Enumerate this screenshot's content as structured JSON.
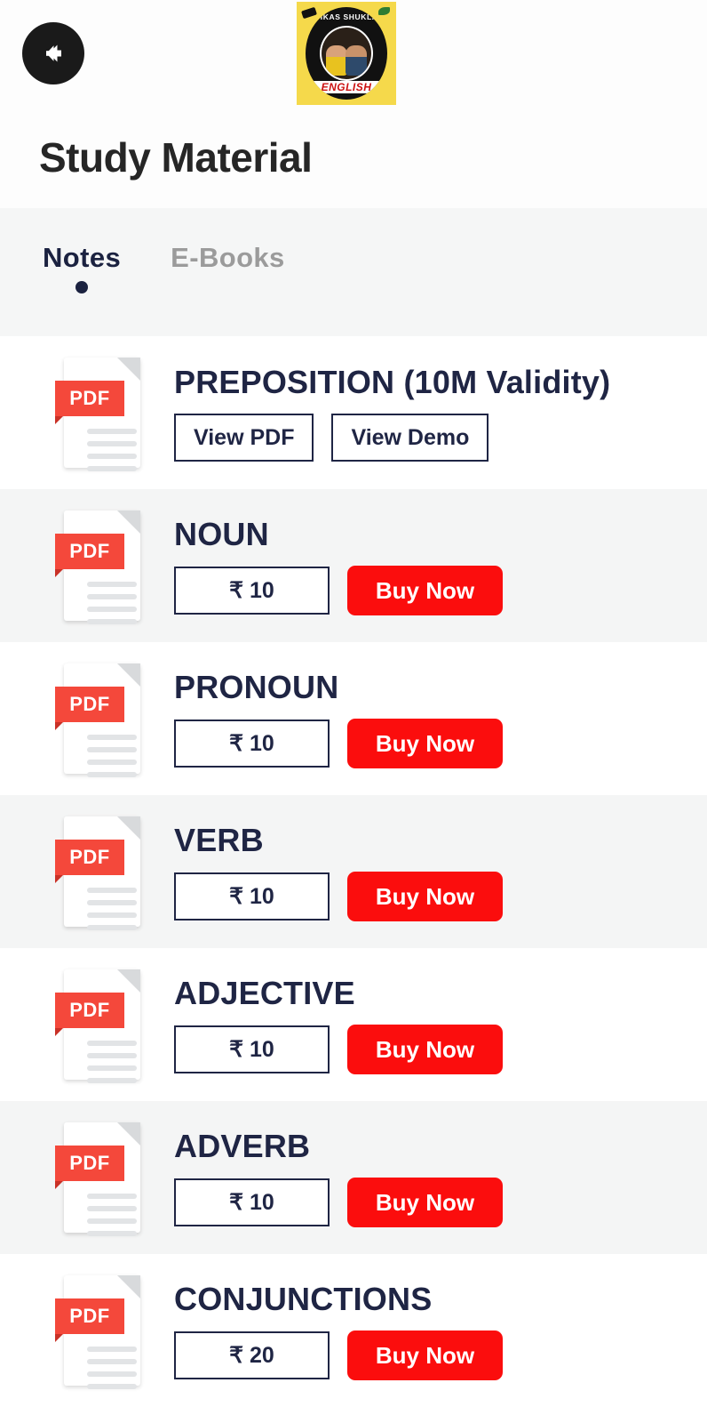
{
  "header": {
    "back_icon": "arrow-left-icon",
    "logo": {
      "top_text": "VIKAS SHUKLA",
      "bottom_text": "ENGLISH"
    }
  },
  "page_title": "Study Material",
  "tabs": [
    {
      "label": "Notes",
      "active": true
    },
    {
      "label": "E-Books",
      "active": false
    }
  ],
  "colors": {
    "accent_red": "#FB0D0D",
    "navy": "#1F2544",
    "pdf_red": "#F4483B",
    "row_gray": "#F4F5F5",
    "logo_yellow": "#F5D94B"
  },
  "items": [
    {
      "title": "PREPOSITION (10M Validity)",
      "icon": "pdf-file-icon",
      "icon_label": "PDF",
      "type": "owned",
      "buttons": [
        {
          "label": "View PDF",
          "style": "outline"
        },
        {
          "label": "View Demo",
          "style": "outline"
        }
      ]
    },
    {
      "title": "NOUN",
      "icon": "pdf-file-icon",
      "icon_label": "PDF",
      "type": "purchasable",
      "price": "₹ 10",
      "buy_label": "Buy Now"
    },
    {
      "title": "PRONOUN",
      "icon": "pdf-file-icon",
      "icon_label": "PDF",
      "type": "purchasable",
      "price": "₹ 10",
      "buy_label": "Buy Now"
    },
    {
      "title": "VERB",
      "icon": "pdf-file-icon",
      "icon_label": "PDF",
      "type": "purchasable",
      "price": "₹ 10",
      "buy_label": "Buy Now"
    },
    {
      "title": "ADJECTIVE",
      "icon": "pdf-file-icon",
      "icon_label": "PDF",
      "type": "purchasable",
      "price": "₹ 10",
      "buy_label": "Buy Now"
    },
    {
      "title": "ADVERB",
      "icon": "pdf-file-icon",
      "icon_label": "PDF",
      "type": "purchasable",
      "price": "₹ 10",
      "buy_label": "Buy Now"
    },
    {
      "title": "CONJUNCTIONS",
      "icon": "pdf-file-icon",
      "icon_label": "PDF",
      "type": "purchasable",
      "price": "₹ 20",
      "buy_label": "Buy Now"
    }
  ]
}
